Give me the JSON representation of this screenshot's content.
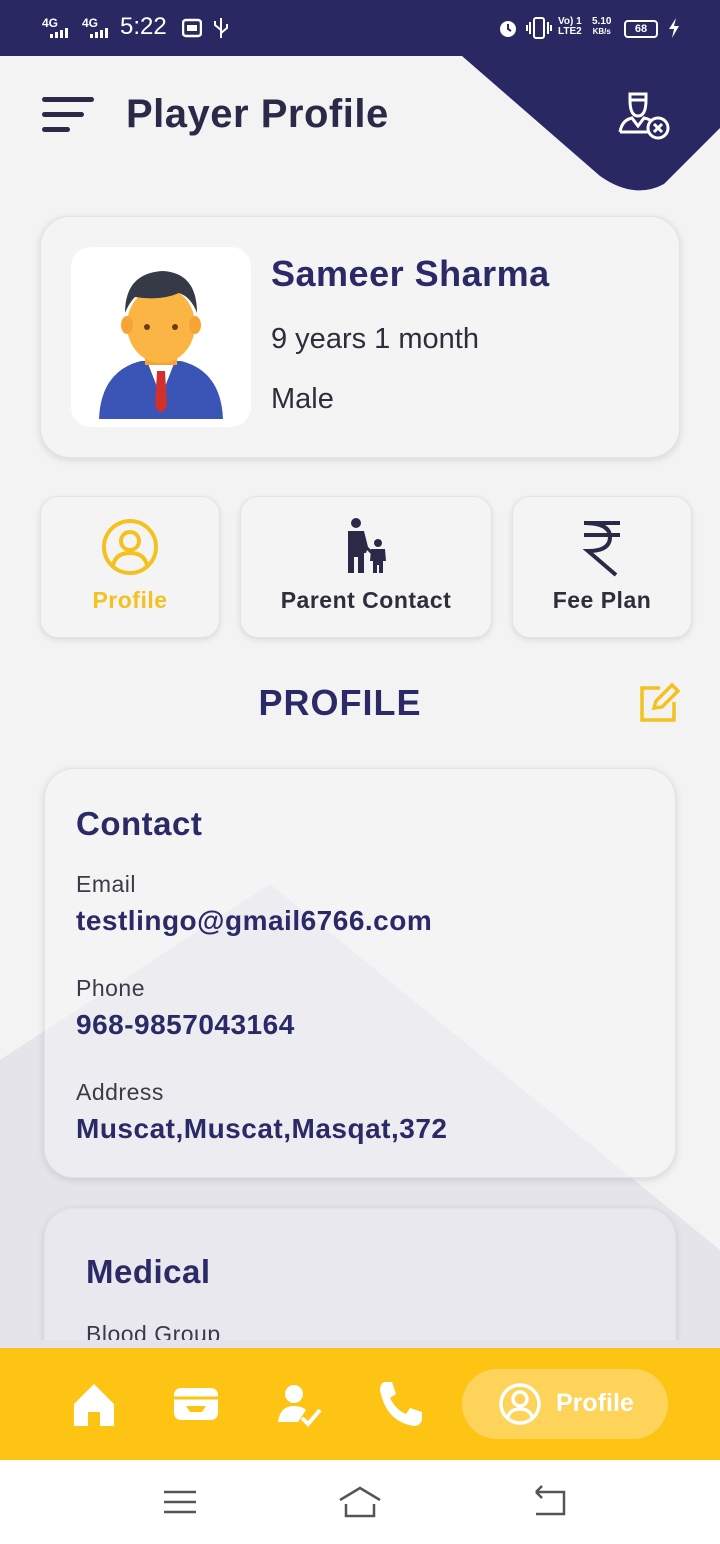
{
  "status_bar": {
    "network_1": "4G",
    "network_2": "4G",
    "time": "5:22",
    "volte_top": "Vo) 1",
    "volte_bottom": "LTE2",
    "speed_top": "5.10",
    "speed_bottom": "KB/s",
    "battery": "68"
  },
  "header": {
    "title": "Player Profile"
  },
  "player": {
    "name": "Sameer Sharma",
    "age": "9 years 1 month",
    "gender": "Male"
  },
  "tabs": [
    {
      "label": "Profile",
      "icon": "user-circle-icon",
      "active": true
    },
    {
      "label": "Parent Contact",
      "icon": "parent-child-icon",
      "active": false
    },
    {
      "label": "Fee Plan",
      "icon": "rupee-icon",
      "active": false
    }
  ],
  "section": {
    "title": "PROFILE"
  },
  "contact": {
    "heading": "Contact",
    "email_label": "Email",
    "email_value": "testlingo@gmail6766.com",
    "phone_label": "Phone",
    "phone_value": "968-9857043164",
    "address_label": "Address",
    "address_value": "Muscat,Muscat,Masqat,372"
  },
  "medical": {
    "heading": "Medical",
    "blood_group_label": "Blood Group"
  },
  "bottom_nav": {
    "items": [
      "home-icon",
      "wallet-icon",
      "attendance-icon",
      "phone-icon"
    ],
    "active_label": "Profile"
  },
  "colors": {
    "primary": "#292863",
    "accent": "#fdc414",
    "heading": "#2a2a66"
  }
}
